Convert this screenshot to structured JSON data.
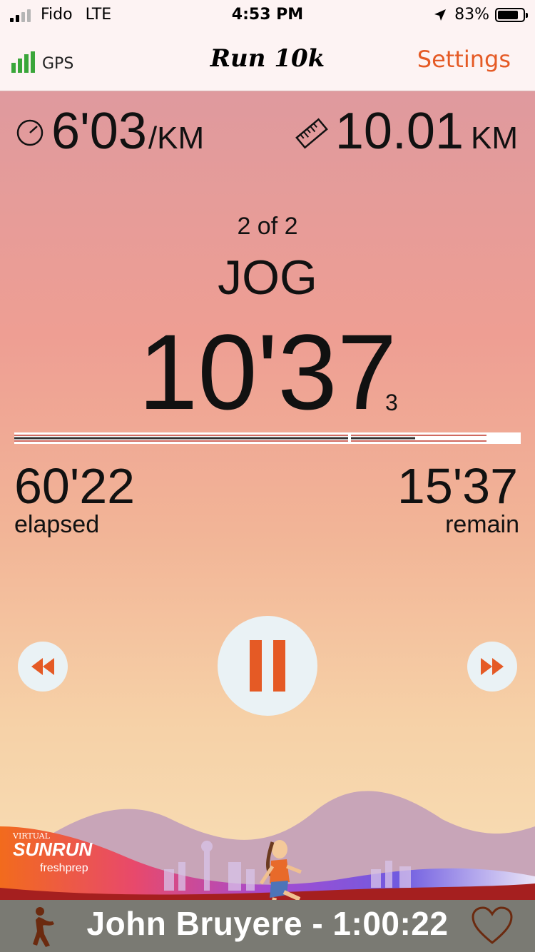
{
  "status_bar": {
    "carrier": "Fido",
    "network": "LTE",
    "time": "4:53 PM",
    "battery": "83%",
    "battery_level": 0.83
  },
  "nav": {
    "gps_label": "GPS",
    "title": "Run 10k",
    "settings_label": "Settings"
  },
  "stats": {
    "pace_value": "6'03",
    "pace_unit": "/KM",
    "distance_value": "10.01",
    "distance_unit": "KM"
  },
  "interval": {
    "step": "2 of 2",
    "phase": "JOG",
    "time": "10'37",
    "tenths": "3"
  },
  "totals": {
    "elapsed_value": "60'22",
    "elapsed_label": "elapsed",
    "remain_value": "15'37",
    "remain_label": "remain"
  },
  "controls": {
    "rewind_icon": "rewind-icon",
    "pause_icon": "pause-icon",
    "forward_icon": "fast-forward-icon"
  },
  "banner": {
    "brand_top": "VIRTUAL",
    "brand_main": "SUNRUN",
    "sponsor": "freshprep"
  },
  "footer": {
    "runner_text": "John Bruyere - 1:00:22",
    "runner_icon": "stretching-person-icon",
    "favorite_icon": "heart-icon"
  },
  "colors": {
    "accent": "#e55a25",
    "gps_green": "#3aa63a",
    "control_bg": "#eaf2f5",
    "footer_bg": "#7a7a73"
  }
}
